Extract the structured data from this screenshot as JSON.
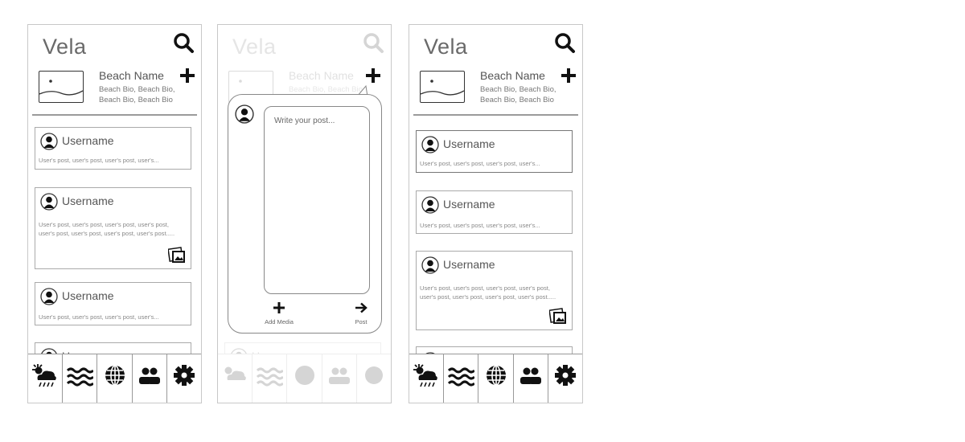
{
  "app": {
    "title": "Vela"
  },
  "beach": {
    "name": "Beach Name",
    "bio": "Beach Bio, Beach Bio, Beach Bio, Beach Bio"
  },
  "posts": [
    {
      "username": "Username",
      "text": "User's post, user's post, user's post, user's..."
    },
    {
      "username": "Username",
      "text": "User's post, user's post, user's post, user's post, user's post, user's post, user's post, user's post....."
    },
    {
      "username": "Username",
      "text": "User's post, user's post, user's post, user's..."
    },
    {
      "username": "Username",
      "text": ""
    }
  ],
  "compose": {
    "placeholder": "Write your post...",
    "add_media_label": "Add Media",
    "post_label": "Post"
  },
  "nav": {
    "items": [
      {
        "icon": "weather-icon"
      },
      {
        "icon": "waves-icon"
      },
      {
        "icon": "globe-icon"
      },
      {
        "icon": "people-icon"
      },
      {
        "icon": "gear-icon"
      }
    ]
  },
  "colors": {
    "border": "#aaaaaa",
    "icon": "#111111",
    "text": "#555555"
  }
}
